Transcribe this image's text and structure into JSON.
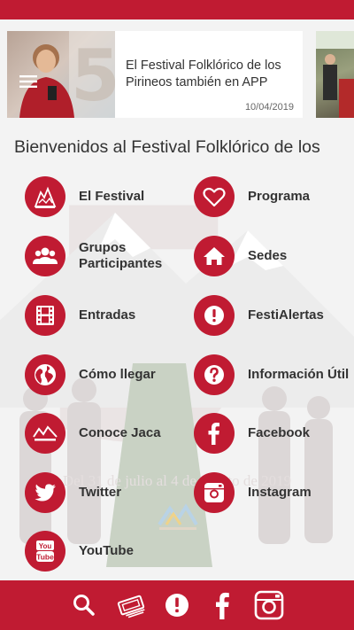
{
  "banner": {
    "title": "El Festival Folklórico de los Pirineos también en APP",
    "date": "10/04/2019"
  },
  "welcome_text": "Bienvenidos al Festival Folklórico de los",
  "background": {
    "dates": "Del 31 de julio al 4 de agosto de 2019"
  },
  "menu": {
    "left": [
      {
        "label": "El Festival",
        "icon": "festival-logo-icon"
      },
      {
        "label": "Grupos Participantes",
        "icon": "group-people-icon"
      },
      {
        "label": "Entradas",
        "icon": "film-strip-icon"
      },
      {
        "label": "Cómo llegar",
        "icon": "globe-icon"
      },
      {
        "label": "Conoce Jaca",
        "icon": "jaca-logo-icon"
      },
      {
        "label": "Twitter",
        "icon": "twitter-icon"
      },
      {
        "label": "YouTube",
        "icon": "youtube-icon"
      }
    ],
    "right": [
      {
        "label": "Programa",
        "icon": "heart-icon"
      },
      {
        "label": "Sedes",
        "icon": "home-icon"
      },
      {
        "label": "FestiAlertas",
        "icon": "alert-icon"
      },
      {
        "label": "Información Útil",
        "icon": "question-icon"
      },
      {
        "label": "Facebook",
        "icon": "facebook-icon"
      },
      {
        "label": "Instagram",
        "icon": "instagram-icon"
      }
    ]
  },
  "bottom_nav": [
    "search-icon",
    "tickets-icon",
    "alert-icon",
    "facebook-icon",
    "instagram-icon"
  ],
  "colors": {
    "brand_red": "#c01b32",
    "text": "#333333"
  }
}
